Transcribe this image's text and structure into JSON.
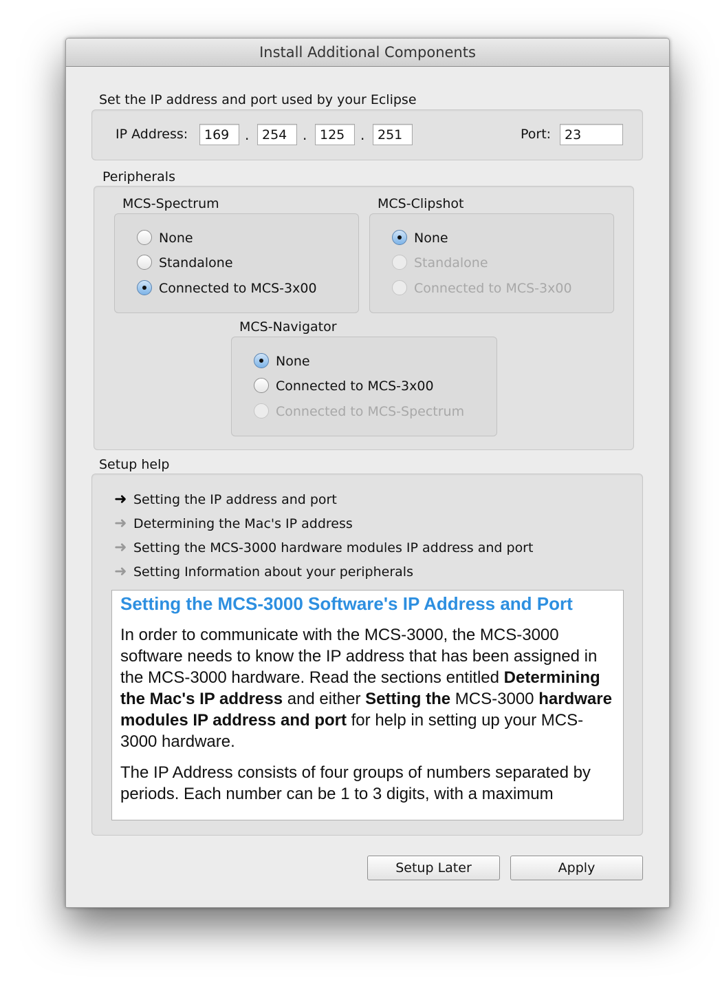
{
  "window": {
    "title": "Install Additional Components"
  },
  "ip_section": {
    "label": "Set the IP address and port used by your Eclipse",
    "ip_label": "IP Address:",
    "octets": [
      "169",
      "254",
      "125",
      "251"
    ],
    "separator": ".",
    "port_label": "Port:",
    "port_value": "23"
  },
  "peripherals": {
    "label": "Peripherals",
    "spectrum": {
      "label": "MCS-Spectrum",
      "options": [
        "None",
        "Standalone",
        "Connected to MCS-3x00"
      ],
      "selected": "Connected to MCS-3x00"
    },
    "clipshot": {
      "label": "MCS-Clipshot",
      "options": [
        "None",
        "Standalone",
        "Connected to MCS-3x00"
      ],
      "selected": "None",
      "disabled": [
        "Standalone",
        "Connected to MCS-3x00"
      ]
    },
    "navigator": {
      "label": "MCS-Navigator",
      "options": [
        "None",
        "Connected to MCS-3x00",
        "Connected to MCS-Spectrum"
      ],
      "selected": "None",
      "disabled": [
        "Connected to MCS-Spectrum"
      ]
    }
  },
  "setup_help": {
    "label": "Setup help",
    "links": [
      "Setting the IP address and port",
      "Determining the Mac's IP address",
      "Setting the MCS-3000 hardware modules IP address and port",
      "Setting Information about your peripherals"
    ],
    "active_link": 0,
    "doc": {
      "title": "Setting the MCS-3000 Software's IP Address and Port",
      "p1_a": "In order to communicate with the MCS-3000, the MCS-3000 software needs to know the IP address that has been assigned in the MCS-3000 hardware. Read the sections entitled ",
      "p1_b1": "Determining the Mac's IP address",
      "p1_c": " and either ",
      "p1_b2": "Setting the",
      "p1_d": " MCS-3000 ",
      "p1_b3": "hardware modules IP address and port",
      "p1_e": " for help in setting up your MCS-3000 hardware.",
      "p2": "The IP Address consists of four groups of numbers separated by periods. Each number can be 1 to 3 digits, with a maximum"
    }
  },
  "buttons": {
    "setup_later": "Setup Later",
    "apply": "Apply"
  },
  "colors": {
    "link_title": "#2d8fe0",
    "window_bg": "#ececec"
  }
}
